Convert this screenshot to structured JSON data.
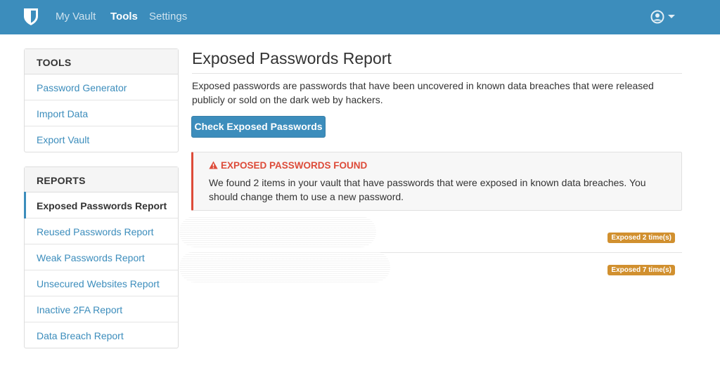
{
  "navbar": {
    "brand_icon": "shield-icon",
    "links": [
      {
        "label": "My Vault",
        "active": false
      },
      {
        "label": "Tools",
        "active": true
      },
      {
        "label": "Settings",
        "active": false
      }
    ],
    "account_icon": "user-circle-icon",
    "color": "#3c8dbc"
  },
  "sidebar": {
    "tools": {
      "title": "TOOLS",
      "items": [
        "Password Generator",
        "Import Data",
        "Export Vault"
      ]
    },
    "reports": {
      "title": "REPORTS",
      "items": [
        "Exposed Passwords Report",
        "Reused Passwords Report",
        "Weak Passwords Report",
        "Unsecured Websites Report",
        "Inactive 2FA Report",
        "Data Breach Report"
      ],
      "active_index": 0
    }
  },
  "main": {
    "title": "Exposed Passwords Report",
    "description": "Exposed passwords are passwords that have been uncovered in known data breaches that were released publicly or sold on the dark web by hackers.",
    "check_button": "Check Exposed Passwords",
    "alert": {
      "title": "EXPOSED PASSWORDS FOUND",
      "body": "We found 2 items in your vault that have passwords that were exposed in known data breaches. You should change them to use a new password.",
      "color": "#dd4b39",
      "icon": "warning-triangle-icon"
    },
    "results": [
      {
        "badge": "Exposed 2 time(s)"
      },
      {
        "badge": "Exposed 7 time(s)"
      }
    ],
    "badge_color": "#d1902f"
  }
}
